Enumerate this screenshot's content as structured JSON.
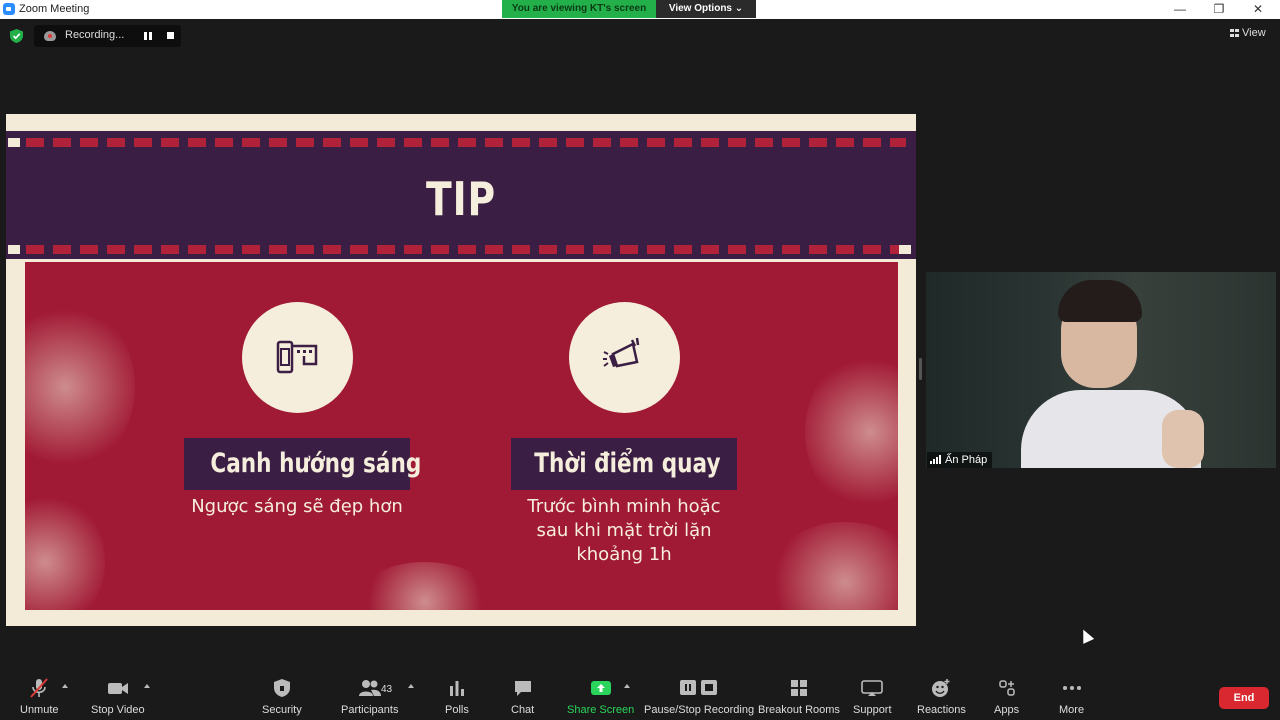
{
  "window": {
    "title": "Zoom Meeting",
    "controls": {
      "minimize": "—",
      "restore": "❐",
      "close": "✕"
    }
  },
  "banner": {
    "viewing": "You are viewing KT's screen",
    "view_options": "View Options ⌄"
  },
  "topbar": {
    "recording_label": "Recording...",
    "view_label": "View"
  },
  "slide": {
    "title": "TIP",
    "colors": {
      "cream": "#f3ead7",
      "purple": "#3a1e44",
      "red": "#a11a35"
    },
    "tips": [
      {
        "icon": "film-roll-icon",
        "heading": "Canh hướng sáng",
        "desc": [
          "Ngược sáng sẽ đẹp hơn"
        ]
      },
      {
        "icon": "megaphone-icon",
        "heading": "Thời điểm quay",
        "desc": [
          "Trước bình minh hoặc",
          "sau khi mặt trời lặn",
          "khoảng 1h"
        ]
      }
    ]
  },
  "participant": {
    "name": "Ấn Pháp"
  },
  "toolbar": {
    "unmute": "Unmute",
    "stop_video": "Stop Video",
    "security": "Security",
    "participants": "Participants",
    "participants_count": "43",
    "polls": "Polls",
    "chat": "Chat",
    "share_screen": "Share Screen",
    "pause_stop_recording": "Pause/Stop Recording",
    "breakout_rooms": "Breakout Rooms",
    "support": "Support",
    "reactions": "Reactions",
    "apps": "Apps",
    "more": "More",
    "end": "End",
    "accent_share": "#2bd45a",
    "end_color": "#d9282f"
  }
}
